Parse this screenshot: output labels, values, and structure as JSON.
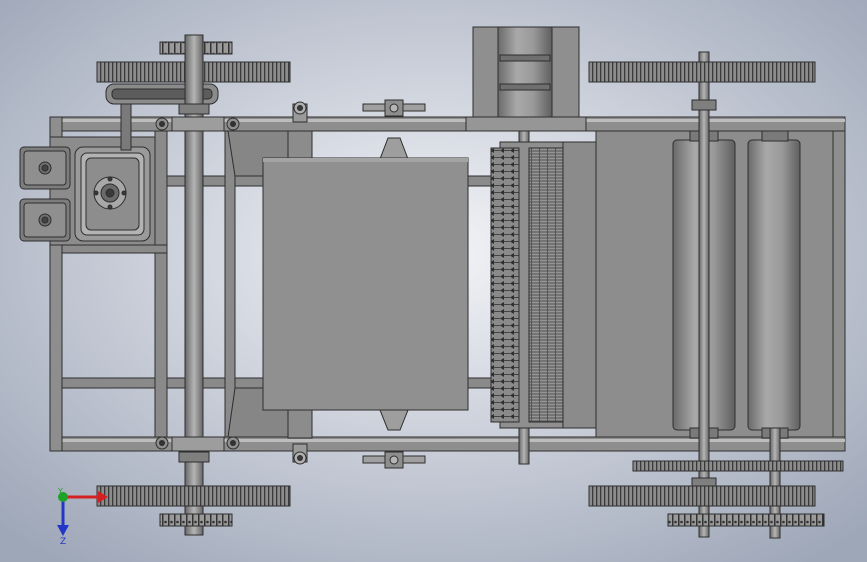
{
  "view": {
    "background_center": "#f3f4f8",
    "background_edge": "#9ea7b8",
    "metal": "#8e8e8e",
    "metal_dark": "#5e5e5e",
    "metal_light": "#bdbdbd",
    "outline": "#2e2e2e"
  },
  "triad": {
    "y_label": "Y",
    "z_label": "Z",
    "x_color": "#d42020",
    "y_color": "#1fa22a",
    "z_color": "#2336c8"
  }
}
